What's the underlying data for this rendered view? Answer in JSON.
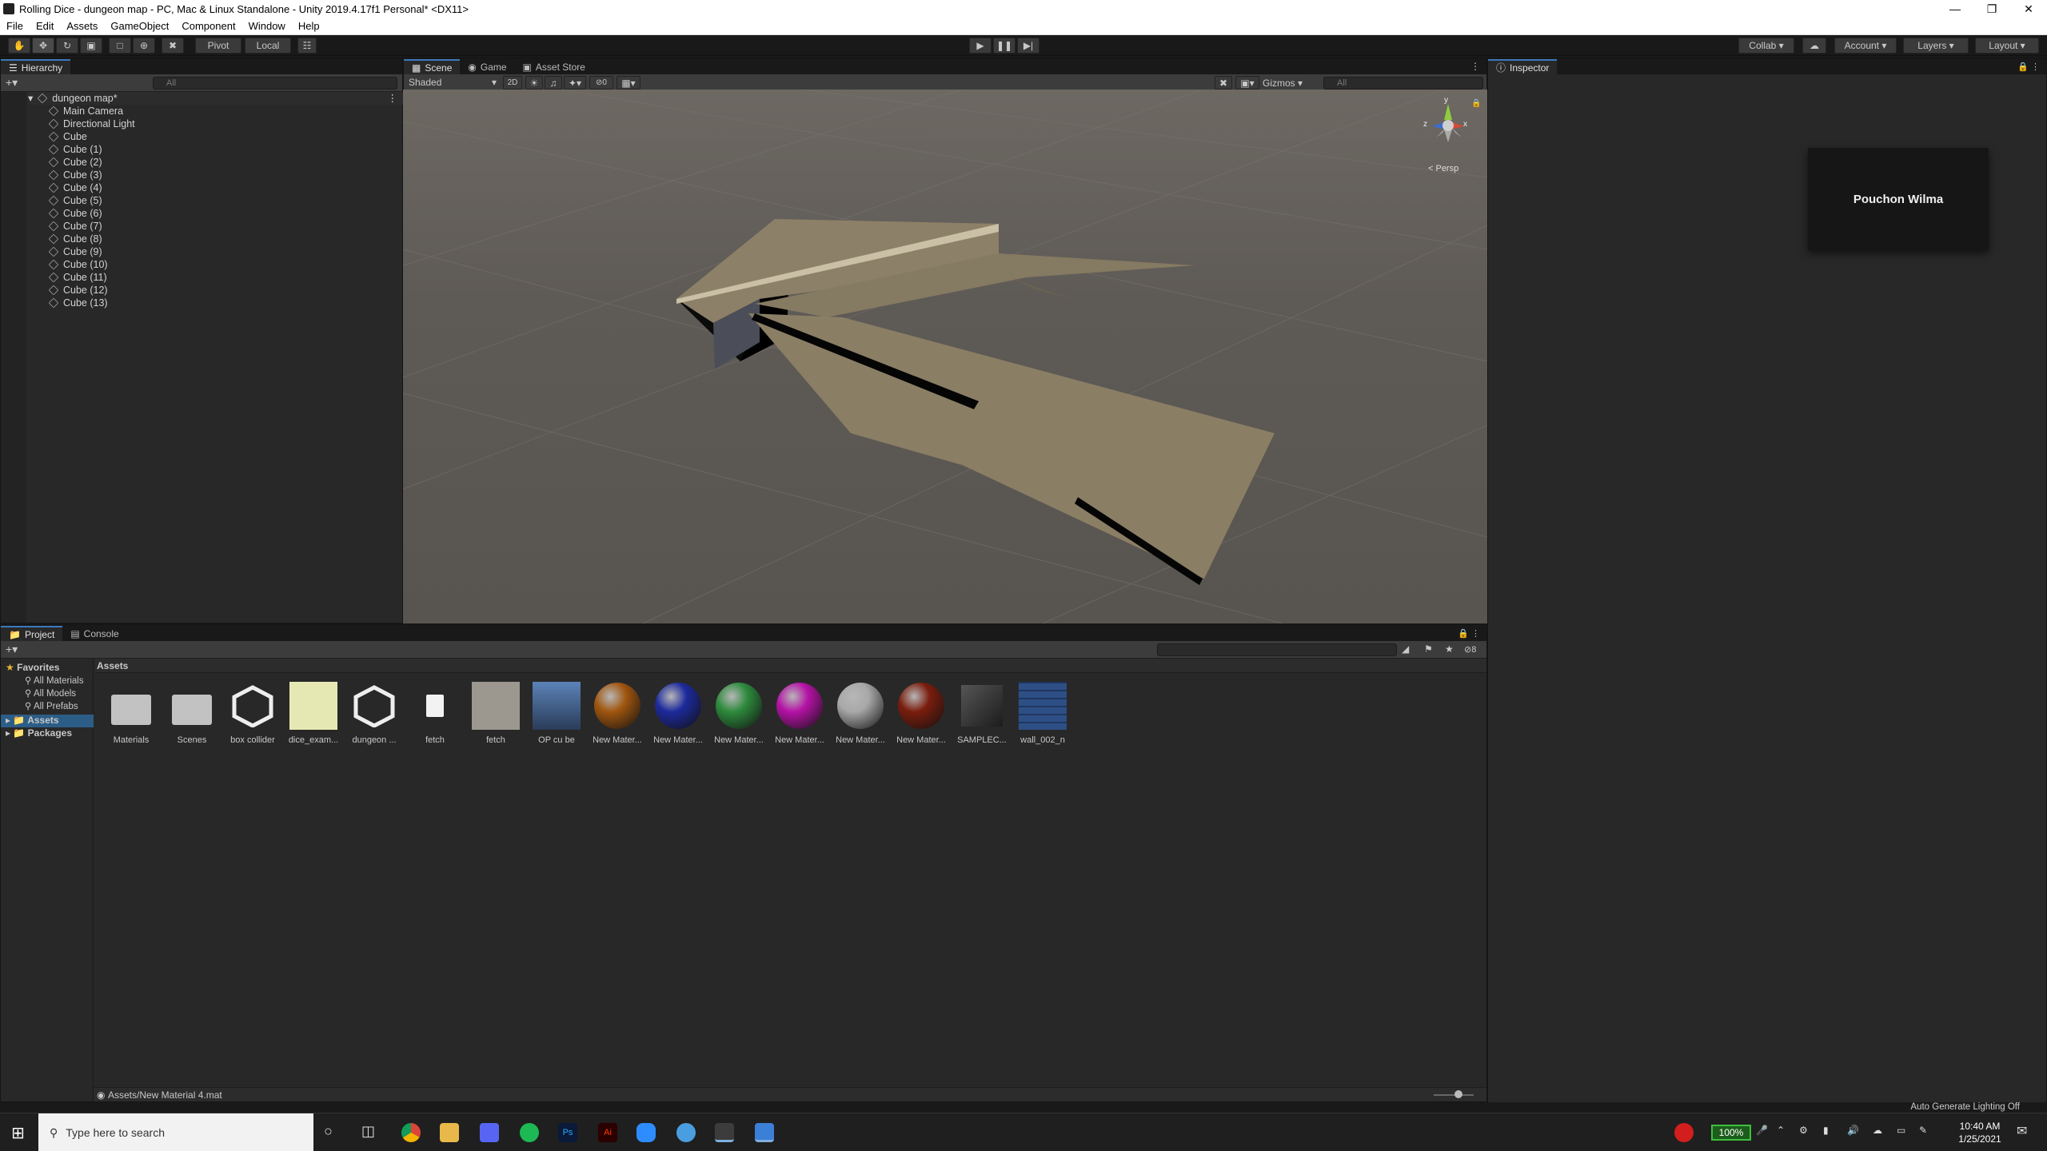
{
  "window": {
    "title": "Rolling Dice - dungeon map - PC, Mac & Linux Standalone - Unity 2019.4.17f1 Personal* <DX11>"
  },
  "menu": [
    "File",
    "Edit",
    "Assets",
    "GameObject",
    "Component",
    "Window",
    "Help"
  ],
  "toolbar": {
    "pivot": "Pivot",
    "local": "Local",
    "collab": "Collab",
    "account": "Account",
    "layers": "Layers",
    "layout": "Layout"
  },
  "hierarchy": {
    "tab": "Hierarchy",
    "search_placeholder": "All",
    "scene": "dungeon map*",
    "items": [
      "Main Camera",
      "Directional Light",
      "Cube",
      "Cube (1)",
      "Cube (2)",
      "Cube (3)",
      "Cube (4)",
      "Cube (5)",
      "Cube (6)",
      "Cube (7)",
      "Cube (8)",
      "Cube (9)",
      "Cube (10)",
      "Cube (11)",
      "Cube (12)",
      "Cube (13)"
    ]
  },
  "sceneview": {
    "tabs": [
      "Scene",
      "Game",
      "Asset Store"
    ],
    "shading": "Shaded",
    "mode2d": "2D",
    "hidden_count": "0",
    "gizmos": "Gizmos",
    "search_placeholder": "All",
    "persp": "< Persp",
    "axis_y": "y",
    "axis_x": "x",
    "axis_z": "z"
  },
  "inspector": {
    "tab": "Inspector",
    "tooltip": "Pouchon Wilma"
  },
  "project": {
    "tabs": [
      "Project",
      "Console"
    ],
    "favorites": "Favorites",
    "favorites_items": [
      "All Materials",
      "All Models",
      "All Prefabs"
    ],
    "folders": [
      "Assets",
      "Packages"
    ],
    "breadcrumb": "Assets",
    "hidden_count": "8",
    "assets": [
      {
        "label": "Materials",
        "kind": "folder"
      },
      {
        "label": "Scenes",
        "kind": "folder"
      },
      {
        "label": "box collider",
        "kind": "unity"
      },
      {
        "label": "dice_exam...",
        "kind": "image"
      },
      {
        "label": "dungeon ...",
        "kind": "unity"
      },
      {
        "label": "fetch",
        "kind": "script"
      },
      {
        "label": "fetch",
        "kind": "texture"
      },
      {
        "label": "OP cu be",
        "kind": "prefab"
      },
      {
        "label": "New Mater...",
        "kind": "material",
        "color": "#a0560f"
      },
      {
        "label": "New Mater...",
        "kind": "material",
        "color": "#1d2a9c"
      },
      {
        "label": "New Mater...",
        "kind": "material",
        "color": "#2e8a3d"
      },
      {
        "label": "New Mater...",
        "kind": "material",
        "color": "#b512a6"
      },
      {
        "label": "New Mater...",
        "kind": "material",
        "color": "#a8a8a8"
      },
      {
        "label": "New Mater...",
        "kind": "material",
        "color": "#7a1d0d"
      },
      {
        "label": "SAMPLEC...",
        "kind": "model"
      },
      {
        "label": "wall_002_n",
        "kind": "normalmap"
      }
    ],
    "status_path": "Assets/New Material 4.mat"
  },
  "statusbar": {
    "lighting": "Auto Generate Lighting Off"
  },
  "taskbar": {
    "search_placeholder": "Type here to search",
    "battery": "100%",
    "time": "10:40 AM",
    "date": "1/25/2021"
  },
  "colors": {
    "accent": "#3a79bb",
    "panel": "#282828",
    "dark": "#191919"
  }
}
